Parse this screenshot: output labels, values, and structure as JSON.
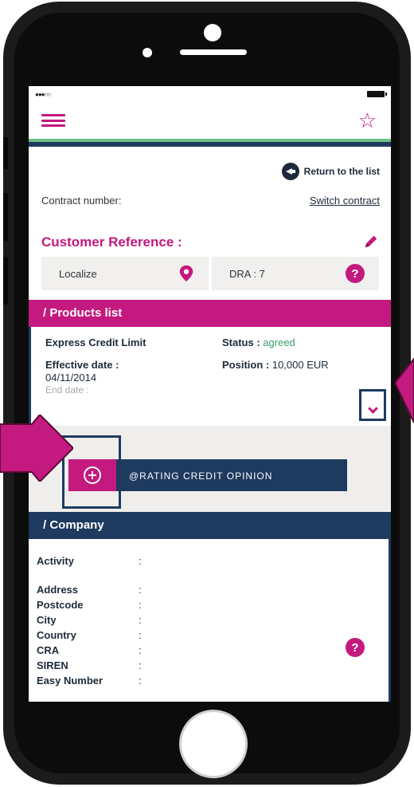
{
  "status_bar": {
    "signal": "●●●○○"
  },
  "header": {
    "menu_icon": "hamburger-icon",
    "favorite_icon": "star-icon"
  },
  "nav": {
    "return_label": "Return to the list"
  },
  "contract": {
    "label": "Contract number:",
    "switch_label": "Switch contract"
  },
  "customer": {
    "title": "Customer Reference :",
    "edit_icon": "pencil-icon"
  },
  "tiles": {
    "localize_label": "Localize",
    "dra_label": "DRA : 7"
  },
  "products": {
    "section_title": "/ Products list",
    "name": "Express Credit Limit",
    "status_label": "Status :",
    "status_value": "agreed",
    "effective_label": "Effective date :",
    "effective_value": "04/11/2014",
    "end_label": "End date :",
    "position_label": "Position :",
    "position_value": "10,000 EUR"
  },
  "rating": {
    "button_label": "@RATING CREDIT OPINION"
  },
  "company": {
    "section_title": "/ Company",
    "fields": [
      "Activity",
      "Address",
      "Postcode",
      "City",
      "Country",
      "CRA",
      "SIREN",
      "Easy Number"
    ],
    "colon": ":"
  },
  "colors": {
    "accent": "#c4197e",
    "navy": "#1e3a5f",
    "green": "#3a9e6a"
  }
}
